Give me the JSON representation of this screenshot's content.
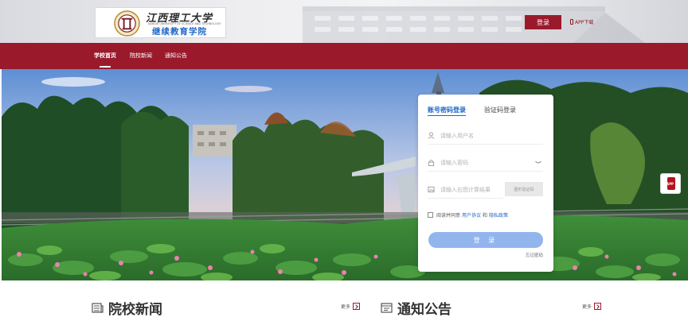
{
  "header": {
    "logo": {
      "cn_name": "江西理工大学",
      "en_name": "JIANGXI UNIVERSITY OF SCIENCE AND TECHNOLOGY",
      "college": "继续教育学院"
    },
    "login_label": "登录",
    "app_download_label": "APP下载"
  },
  "nav": {
    "items": [
      {
        "label": "学校首页",
        "active": true
      },
      {
        "label": "院校新闻",
        "active": false
      },
      {
        "label": "通知公告",
        "active": false
      }
    ]
  },
  "login_card": {
    "tabs": [
      "账号密码登录",
      "验证码登录"
    ],
    "username_placeholder": "请输入用户名",
    "password_placeholder": "请输入密码",
    "captcha_placeholder": "请输入右图计算结果",
    "captcha_text": "图形验证码",
    "agree": {
      "prefix": "阅读并同意",
      "user_agreement": "用户协议",
      "and": "和",
      "privacy_policy": "隐私政策"
    },
    "submit_label": "登 录",
    "forgot_label": "忘记密码"
  },
  "app_float": {
    "label": "APP"
  },
  "sections": {
    "news": {
      "title": "院校新闻",
      "more": "更多"
    },
    "notice": {
      "title": "通知公告",
      "more": "更多"
    }
  },
  "colors": {
    "brand": "#9a1a2b",
    "primary": "#1e66c7",
    "submit": "#92b5ee"
  }
}
